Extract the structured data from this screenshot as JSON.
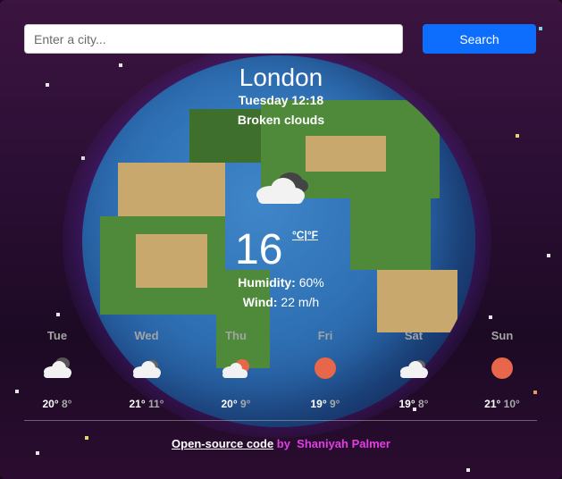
{
  "search": {
    "placeholder": "Enter a city...",
    "value": "",
    "button_label": "Search"
  },
  "current": {
    "city": "London",
    "datetime": "Tuesday 12:18",
    "description": "Broken clouds",
    "icon": "broken-clouds-icon",
    "temperature": "16",
    "unit_celsius": "°C|",
    "unit_fahrenheit": "°F",
    "humidity_label": "Humidity:",
    "humidity_value": " 60%",
    "wind_label": "Wind:",
    "wind_value": " 22 m/h"
  },
  "forecast": [
    {
      "day": "Tue",
      "max": "20°",
      "min": "8°",
      "icon": "broken-clouds-icon"
    },
    {
      "day": "Wed",
      "max": "21°",
      "min": "11°",
      "icon": "clouds-icon"
    },
    {
      "day": "Thu",
      "max": "20°",
      "min": "9°",
      "icon": "partly-cloudy-icon"
    },
    {
      "day": "Fri",
      "max": "19°",
      "min": "9°",
      "icon": "sun-icon"
    },
    {
      "day": "Sat",
      "max": "19°",
      "min": "8°",
      "icon": "clouds-icon"
    },
    {
      "day": "Sun",
      "max": "21°",
      "min": "10°",
      "icon": "sun-icon"
    }
  ],
  "footer": {
    "link_text": "Open-source code",
    "by_text": " by  Shaniyah Palmer"
  },
  "colors": {
    "accent": "#0d6efd",
    "author": "#e23ee6",
    "sun": "#e8674a",
    "min_temp": "#a9a9a9"
  }
}
